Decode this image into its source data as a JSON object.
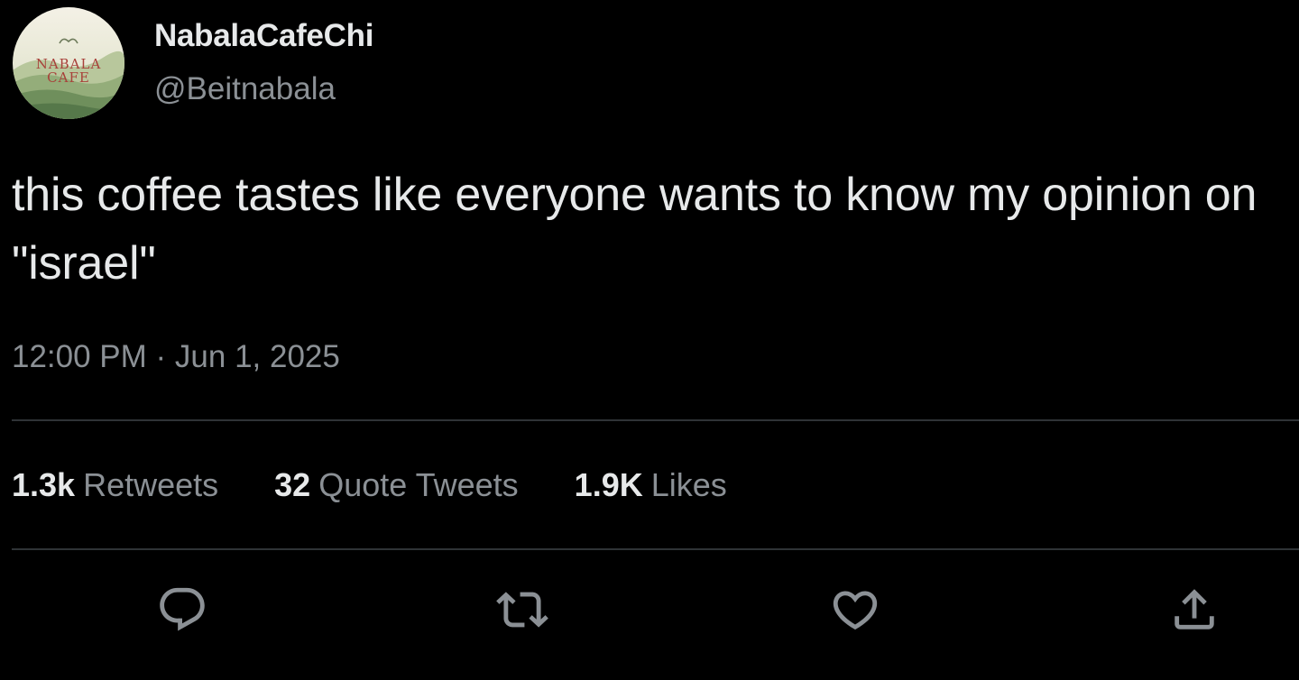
{
  "author": {
    "name": "NabalaCafeChi",
    "handle": "@Beitnabala",
    "avatar_logo_text": [
      "NABALA",
      "CAFE"
    ]
  },
  "tweet": {
    "text": "this coffee tastes like everyone wants to know my opinion on \"israel\"",
    "timestamp": "12:00 PM · Jun 1, 2025"
  },
  "stats": [
    {
      "count": "1.3k",
      "label": "Retweets"
    },
    {
      "count": "32",
      "label": "Quote Tweets"
    },
    {
      "count": "1.9K",
      "label": "Likes"
    }
  ],
  "actions": [
    {
      "icon": "reply-icon"
    },
    {
      "icon": "retweet-icon"
    },
    {
      "icon": "like-heart-icon"
    },
    {
      "icon": "share-icon"
    }
  ],
  "colors": {
    "background": "#000000",
    "primary_text": "#e7e9ea",
    "secondary_text": "#8b9095",
    "divider": "#2f3336",
    "avatar_green": "#6f8f5c",
    "avatar_logo_red": "#a8413a"
  }
}
